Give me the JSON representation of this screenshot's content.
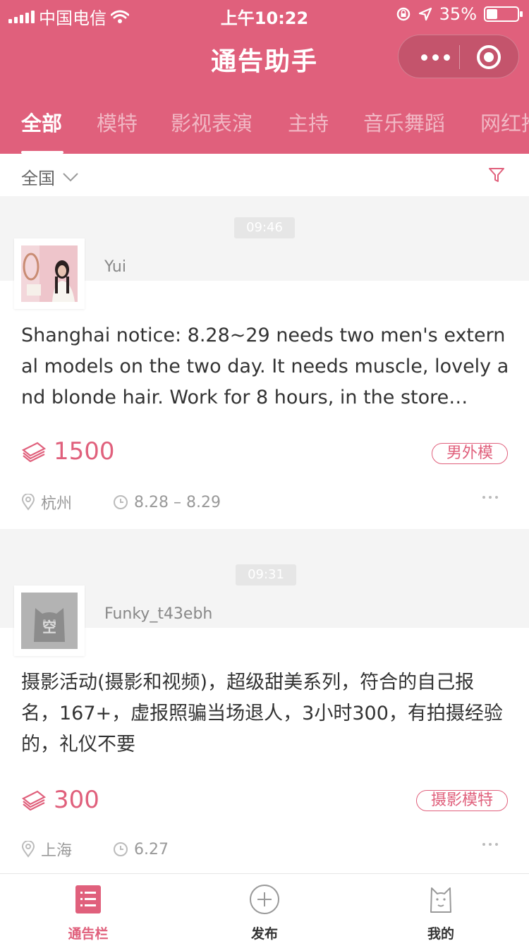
{
  "status_bar": {
    "carrier": "中国电信",
    "time": "上午10:22",
    "battery": "35%",
    "battery_level": 0.35
  },
  "nav": {
    "title": "通告助手"
  },
  "tabs": [
    "全部",
    "模特",
    "影视表演",
    "主持",
    "音乐舞蹈",
    "网红推"
  ],
  "filter": {
    "region": "全国"
  },
  "posts": [
    {
      "time": "09:46",
      "user": "Yui",
      "text": " Shanghai notice: 8.28~29 needs two men's external models on the two day. It needs muscle, lovely and blonde hair. Work for 8 hours, in the store…",
      "price": "1500",
      "tag": "男外模",
      "location": "杭州",
      "date": "8.28 – 8.29"
    },
    {
      "time": "09:31",
      "user": "Funky_t43ebh",
      "avatar_text": "空",
      "text": " 摄影活动(摄影和视频)，超级甜美系列，符合的自己报名，167+，虚报照骗当场退人，3小时300，有拍摄经验的，礼仪不要",
      "price": "300",
      "tag": "摄影模特",
      "location": "上海",
      "date": "6.27"
    }
  ],
  "tabbar": {
    "items": [
      "通告栏",
      "发布",
      "我的"
    ]
  },
  "colors": {
    "brand": "#e0607c",
    "text": "#333333",
    "muted": "#999999"
  }
}
